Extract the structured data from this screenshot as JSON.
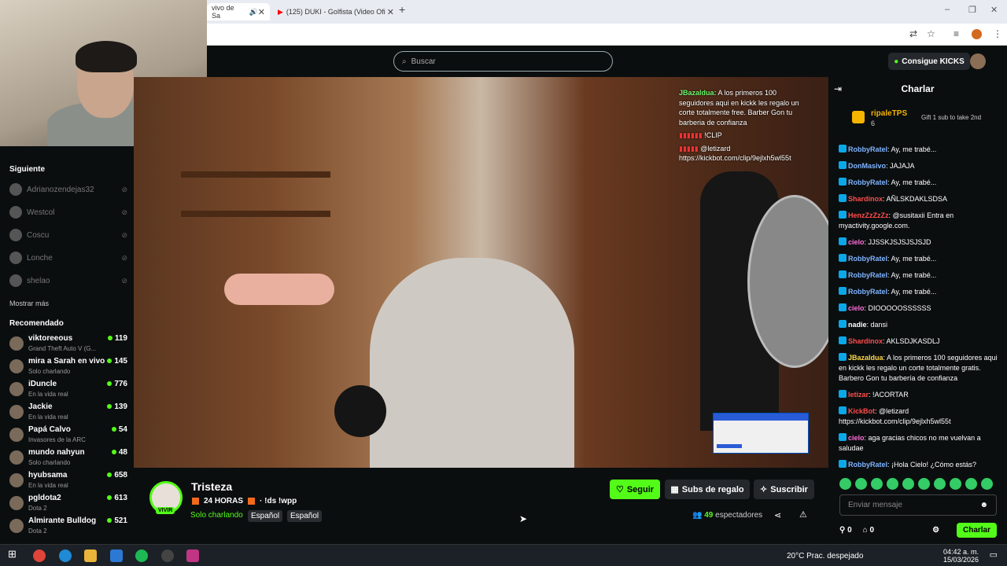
{
  "browser": {
    "tab1_title": "vivo de Sa",
    "tab2_title": "(125) DUKI - Golfista (Video Ofi",
    "new_tab_icon": "plus-icon"
  },
  "topbar": {
    "search_placeholder": "Buscar",
    "kicks_label": "Consigue KICKS"
  },
  "sidebar": {
    "following_heading": "Siguiente",
    "following": [
      {
        "name": "Adrianozendejas32"
      },
      {
        "name": "Westcol"
      },
      {
        "name": "Coscu"
      },
      {
        "name": "Lonche"
      },
      {
        "name": "shelao"
      }
    ],
    "show_more": "Mostrar más",
    "recommended_heading": "Recomendado",
    "recommended": [
      {
        "name": "viktoreeous",
        "category": "Grand Theft Auto V (G...",
        "viewers": "119"
      },
      {
        "name": "mira a Sarah en vivo",
        "category": "Solo charlando",
        "viewers": "145"
      },
      {
        "name": "iDuncle",
        "category": "En la vida real",
        "viewers": "776"
      },
      {
        "name": "Jackie",
        "category": "En la vida real",
        "viewers": "139"
      },
      {
        "name": "Papá Calvo",
        "category": "Invasores de la ARC",
        "viewers": "54"
      },
      {
        "name": "mundo nahyun",
        "category": "Solo charlando",
        "viewers": "48"
      },
      {
        "name": "hyubsama",
        "category": "En la vida real",
        "viewers": "658"
      },
      {
        "name": "pgldota2",
        "category": "Dota 2",
        "viewers": "613"
      },
      {
        "name": "Almirante Bulldog",
        "category": "Dota 2",
        "viewers": "521"
      }
    ]
  },
  "video_overlay": {
    "msg1_user": "JBazaldua:",
    "msg1_text": "A los primeros 100 seguidores aqui en kickk les regalo un corte totalmente free. Barber Gon tu barberia de confianza",
    "msg2_text": "!CLIP",
    "msg3_text": "@letizard https://kickbot.com/clip/9ejlxh5wl55t"
  },
  "stream": {
    "title": "Tristeza",
    "subtitle_hours": "24  HORAS",
    "subtitle_cmds": "· !ds !wpp",
    "live_badge": "VIVIR",
    "category": "Solo charlando",
    "tag1": "Español",
    "tag2": "Español",
    "follow_label": "Seguir",
    "gift_label": "Subs de regalo",
    "subscribe_label": "Suscribir",
    "viewers_count": "49",
    "viewers_label": "espectadores"
  },
  "chat": {
    "header": "Charlar",
    "pinned_user": "ripaleTPS",
    "pinned_count": "6",
    "pinned_text": "Gift 1 sub to take 2nd",
    "messages": [
      {
        "user": "RobbyRatel",
        "color": "#7fb4ff",
        "text": ": Ay, me trabé..."
      },
      {
        "user": "DonMasivo",
        "color": "#7fb4ff",
        "text": ": JAJAJA"
      },
      {
        "user": "RobbyRatel",
        "color": "#7fb4ff",
        "text": ": Ay, me trabé..."
      },
      {
        "user": "Shardinox",
        "color": "#ff4d4d",
        "text": ": AÑLSKDAKLSDSA"
      },
      {
        "user": "HenzZzZzZz",
        "color": "#ff4d4d",
        "text": ": @susitaxii Entra en myactivity.google.com."
      },
      {
        "user": "cielo",
        "color": "#ff6fd8",
        "text": ": JJSSKJSJSJSJSJD"
      },
      {
        "user": "RobbyRatel",
        "color": "#7fb4ff",
        "text": ": Ay, me trabé..."
      },
      {
        "user": "RobbyRatel",
        "color": "#7fb4ff",
        "text": ": Ay, me trabé..."
      },
      {
        "user": "RobbyRatel",
        "color": "#7fb4ff",
        "text": ": Ay, me trabé..."
      },
      {
        "user": "cielo",
        "color": "#ff6fd8",
        "text": ": DIOOOOOSSSSSS"
      },
      {
        "user": "nadie",
        "color": "#ffffff",
        "text": ": dansi"
      },
      {
        "user": "Shardinox",
        "color": "#ff4d4d",
        "text": ": AKLSDJKASDLJ"
      },
      {
        "user": "JBazaldua",
        "color": "#ffd84d",
        "text": ": A los primeros 100 seguidores aqui en kickk les regalo un corte totalmente gratis. Barbero Gon tu barbería de confianza"
      },
      {
        "user": "letizar",
        "color": "#ff4d4d",
        "text": ": !ACORTAR"
      },
      {
        "user": "KickBot",
        "color": "#ff4d4d",
        "text": ": @letizard https://kickbot.com/clip/9ejlxh5wl55t"
      },
      {
        "user": "cielo",
        "color": "#ff6fd8",
        "text": ": aga gracias chicos no me vuelvan a saludae"
      },
      {
        "user": "RobbyRatel",
        "color": "#7fb4ff",
        "text": ": ¡Hola Cielo! ¿Cómo estás?"
      }
    ],
    "input_placeholder": "Enviar mensaje",
    "points1": "0",
    "points2": "0",
    "send_label": "Charlar"
  },
  "taskbar": {
    "weather": "20°C  Prac. despejado",
    "time": "04:42 a. m.",
    "date": "15/03/2026"
  }
}
